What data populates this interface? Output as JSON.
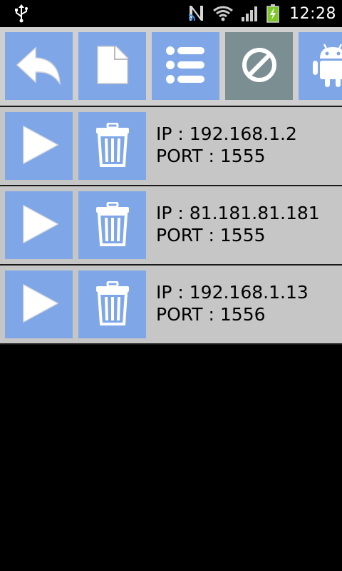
{
  "statusbar": {
    "time": "12:28",
    "icons": [
      "usb-icon",
      "nfc-icon",
      "wifi-icon",
      "signal-icon",
      "battery-charging-icon"
    ]
  },
  "toolbar": {
    "buttons": [
      {
        "name": "back",
        "icon": "reply-arrow-icon",
        "state": "enabled"
      },
      {
        "name": "new",
        "icon": "file-icon",
        "state": "enabled"
      },
      {
        "name": "list",
        "icon": "list-icon",
        "state": "enabled"
      },
      {
        "name": "block",
        "icon": "prohibit-icon",
        "state": "disabled"
      },
      {
        "name": "android",
        "icon": "android-icon",
        "state": "enabled"
      }
    ]
  },
  "connections": [
    {
      "ip": "IP : 192.168.1.2",
      "port": "PORT : 1555"
    },
    {
      "ip": "IP : 81.181.81.181",
      "port": "PORT : 1555"
    },
    {
      "ip": "IP : 192.168.1.13",
      "port": "PORT : 1556"
    }
  ],
  "colors": {
    "button_blue": "#7fa7e8",
    "button_disabled": "#7b8f93",
    "row_bg": "#c6c6c6",
    "toolbar_bg": "#cfcfcf",
    "battery_green": "#7ec82a"
  }
}
